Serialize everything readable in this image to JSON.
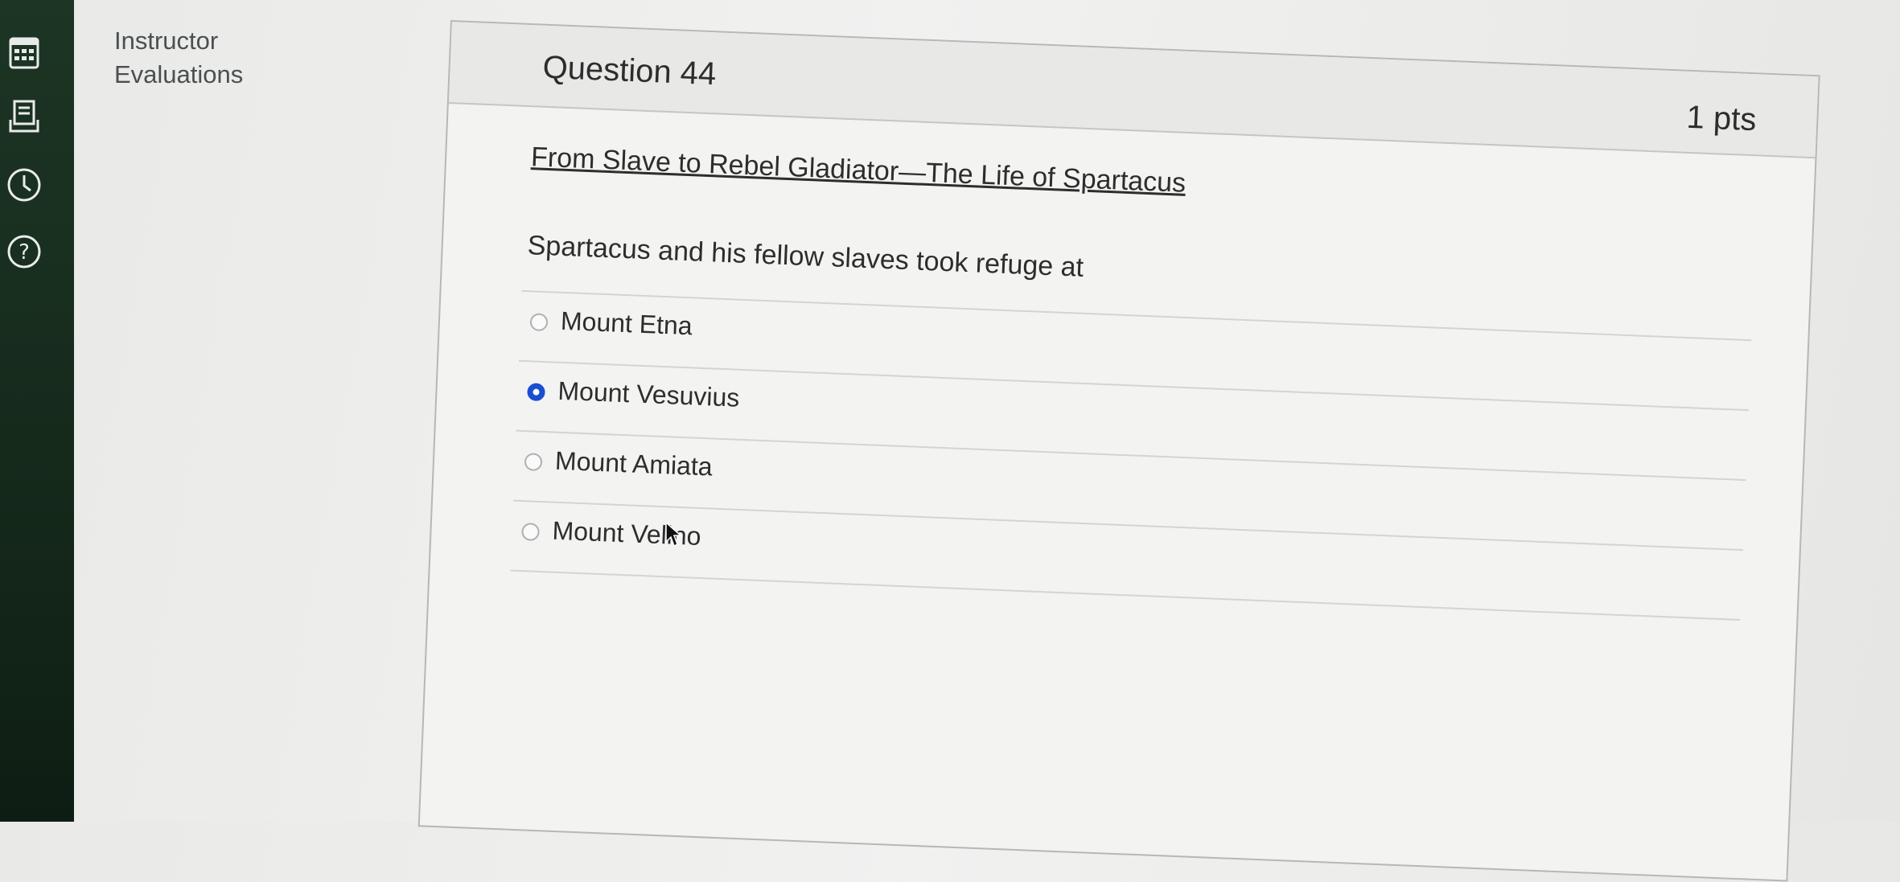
{
  "sidebar": {
    "icons": [
      "calendar-icon",
      "inbox-icon",
      "history-icon",
      "help-icon"
    ]
  },
  "side_link": {
    "line1": "Instructor",
    "line2": "Evaluations"
  },
  "question": {
    "title": "Question 44",
    "points": "1 pts",
    "passage_title": "From Slave to Rebel Gladiator—The Life of Spartacus",
    "prompt": "Spartacus and his fellow slaves took refuge at",
    "answers": [
      {
        "label": "Mount Etna",
        "selected": false
      },
      {
        "label": "Mount Vesuvius",
        "selected": true
      },
      {
        "label": "Mount Amiata",
        "selected": false
      },
      {
        "label": "Mount Velino",
        "selected": false
      }
    ]
  },
  "colors": {
    "sidebar": "#1d3524",
    "selected_radio": "#1a4ed1"
  }
}
